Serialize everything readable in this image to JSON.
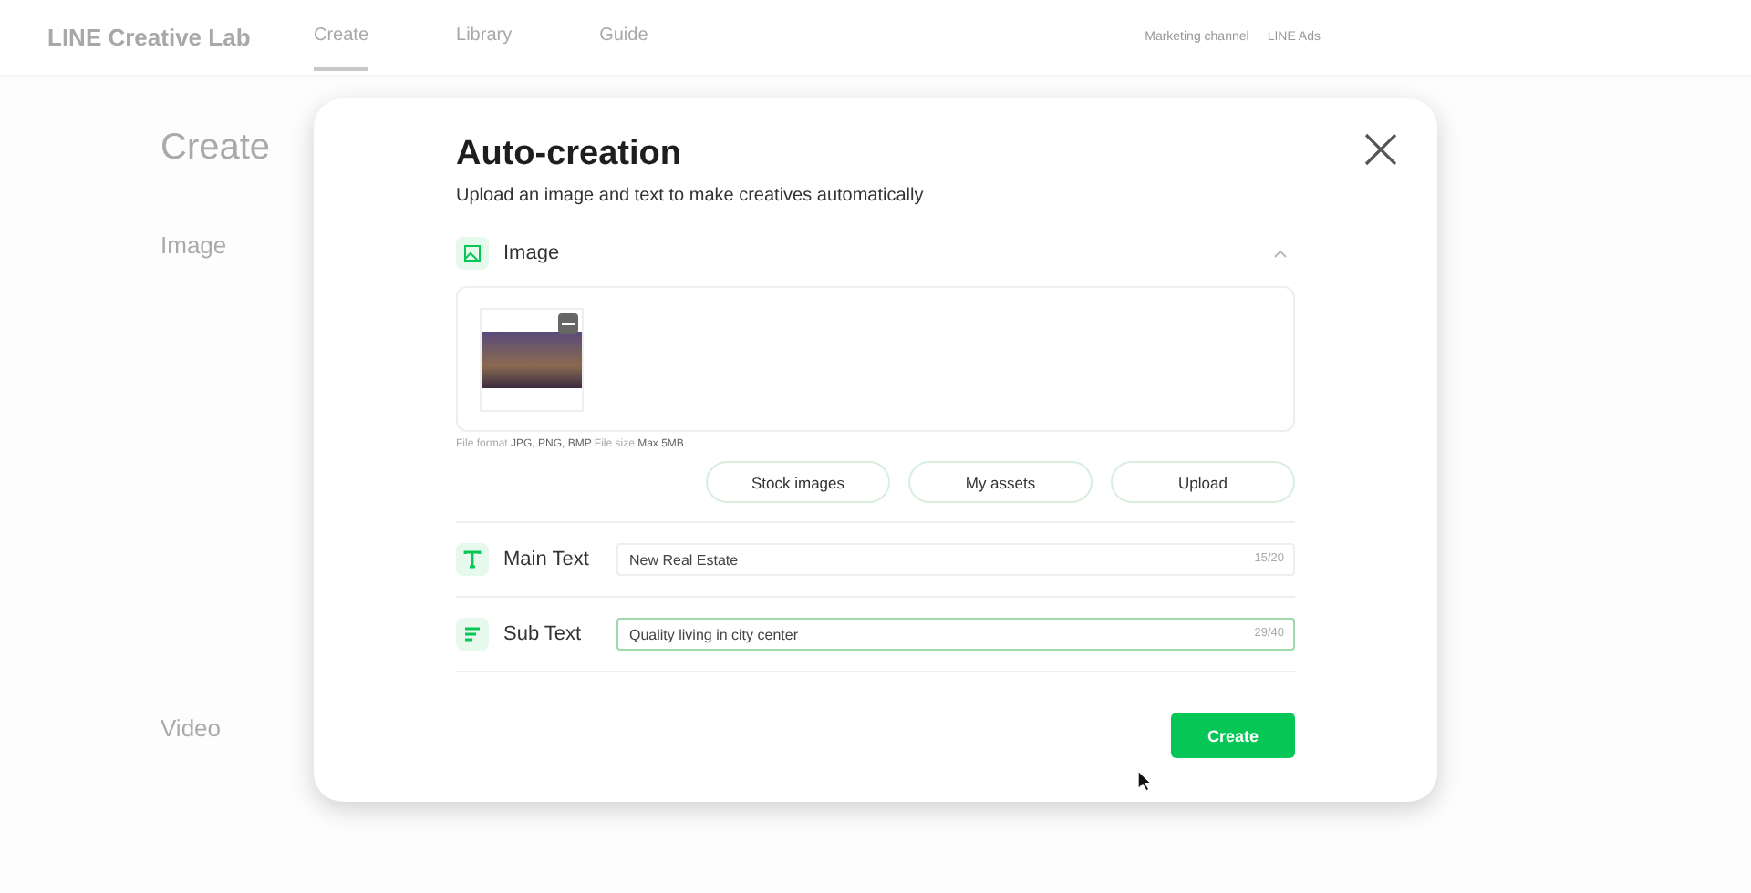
{
  "header": {
    "brand": "LINE Creative Lab",
    "nav": [
      {
        "label": "Create",
        "selected": true
      },
      {
        "label": "Library",
        "selected": false
      },
      {
        "label": "Guide",
        "selected": false
      }
    ],
    "links": [
      "Marketing channel",
      "LINE Ads"
    ]
  },
  "background": {
    "title": "Create",
    "sections": [
      "Image",
      "Video"
    ]
  },
  "dialog": {
    "title": "Auto-creation",
    "subtitle": "Upload an image and text to make creatives automatically",
    "image_section": {
      "label": "Image",
      "expanded": true,
      "file_info": "File format **JPG, PNG, BMP** File size **Max 5MB**",
      "buttons": [
        "Stock images",
        "My assets",
        "Upload"
      ]
    },
    "fields": [
      {
        "kind": "title",
        "label": "Main Text",
        "value": "New Real Estate",
        "counter": "15/20",
        "focused": false
      },
      {
        "kind": "lines",
        "label": "Sub Text",
        "value": "Quality living in city center",
        "counter": "29/40",
        "focused": true
      }
    ],
    "submit": "Create"
  }
}
